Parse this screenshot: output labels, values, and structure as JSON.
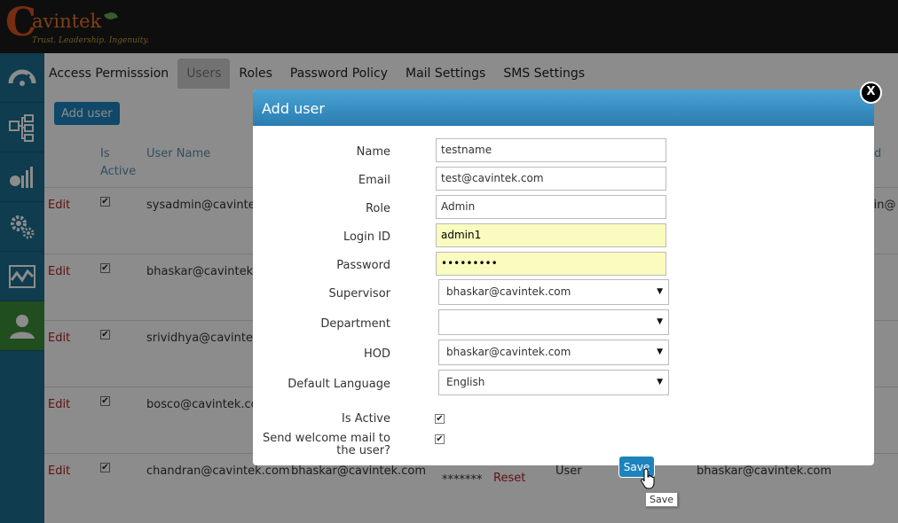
{
  "brand": {
    "c_letter": "C",
    "name": "avintek",
    "tagline": "Trust. Leadership. Ingenuity."
  },
  "tabs": [
    {
      "label": "Access Permisssion"
    },
    {
      "label": "Users"
    },
    {
      "label": "Roles"
    },
    {
      "label": "Password Policy"
    },
    {
      "label": "Mail Settings"
    },
    {
      "label": "SMS Settings"
    }
  ],
  "toolbar": {
    "add_user_label": "Add user"
  },
  "table": {
    "headers": {
      "is_active": "Is\nActive",
      "user_name": "User Name",
      "partial_right": "d"
    },
    "edit_label": "Edit",
    "rows": [
      {
        "user": "sysadmin@cavintek.",
        "right_partial": "min@"
      },
      {
        "user": "bhaskar@cavintek.co"
      },
      {
        "user": "srividhya@cavintek."
      },
      {
        "user": "bosco@cavintek.com"
      },
      {
        "user": "chandran@cavintek.com",
        "supervisor": "bhaskar@cavintek.com",
        "password": "*******",
        "reset": "Reset",
        "role": "User",
        "hod": "bhaskar@cavintek.com"
      }
    ]
  },
  "modal": {
    "title": "Add user",
    "close_label": "X",
    "fields": {
      "name": {
        "label": "Name",
        "value": "testname"
      },
      "email": {
        "label": "Email",
        "value": "test@cavintek.com"
      },
      "role": {
        "label": "Role",
        "value": "Admin"
      },
      "login_id": {
        "label": "Login ID",
        "value": "admin1"
      },
      "password": {
        "label": "Password",
        "value": "•••••••••"
      },
      "supervisor": {
        "label": "Supervisor",
        "value": "bhaskar@cavintek.com"
      },
      "department": {
        "label": "Department",
        "value": ""
      },
      "hod": {
        "label": "HOD",
        "value": "bhaskar@cavintek.com"
      },
      "language": {
        "label": "Default Language",
        "value": "English"
      },
      "is_active": {
        "label": "Is Active"
      },
      "welcome_mail": {
        "label_line1": "Send welcome mail to",
        "label_line2": "the user?"
      }
    },
    "save_label": "Save",
    "save_tooltip": "Save"
  },
  "colors": {
    "accent": "#1d83bd",
    "sidebar": "#1c6e8e",
    "sidebar_active": "#3c8f3a",
    "edit_link": "#b02020",
    "autofill": "#fafcbf"
  },
  "icons": {
    "sidebar": [
      "dashboard-gauge-icon",
      "workflow-icon",
      "bar-chart-icon",
      "gears-icon",
      "line-chart-icon",
      "user-icon"
    ]
  }
}
